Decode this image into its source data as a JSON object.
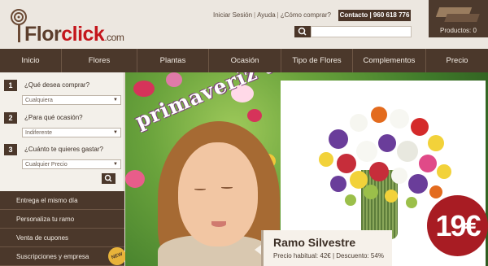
{
  "brand": {
    "name_part1": "Flor",
    "name_part2": "click",
    "tld": ".com"
  },
  "toplinks": {
    "login": "Iniciar Sesión",
    "help": "Ayuda",
    "how_to_buy": "¿Cómo comprar?",
    "contact": "Contacto | 960 618 776"
  },
  "search": {
    "placeholder": ""
  },
  "cart": {
    "label": "Productos: 0"
  },
  "nav": {
    "items": [
      "Inicio",
      "Flores",
      "Plantas",
      "Ocasión",
      "Tipo de Flores",
      "Complementos",
      "Precio"
    ]
  },
  "finder": {
    "q1": {
      "num": "1",
      "label": "¿Qué desea comprar?",
      "value": "Cualquiera"
    },
    "q2": {
      "num": "2",
      "label": "¿Para qué ocasión?",
      "value": "Indiferente"
    },
    "q3": {
      "num": "3",
      "label": "¿Cuánto te quieres gastar?",
      "value": "Cualquier Precio"
    }
  },
  "side_links": [
    "Entrega el mismo día",
    "Personaliza tu ramo",
    "Venta de cupones",
    "Suscripciones y empresa"
  ],
  "new_badge": "NEW",
  "banner": {
    "headline": "primaveríz ate",
    "product_name": "Ramo Silvestre",
    "product_price_info": "Precio habitual: 42€ | Descuento: 54%",
    "price": "19€"
  },
  "colors": {
    "brand_brown": "#4b382b",
    "accent_red": "#a81c23"
  }
}
